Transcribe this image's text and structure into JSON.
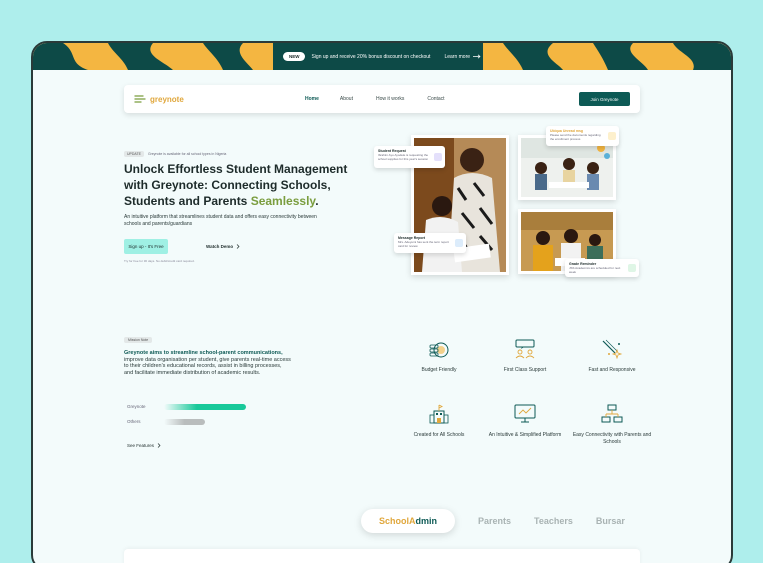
{
  "banner": {
    "badge": "NEW",
    "message": "Sign up and receive 20% bonus discount on checkout",
    "link": "Learn more"
  },
  "nav": {
    "logo": "greynote",
    "links": [
      "Home",
      "About",
      "How it works",
      "Contact"
    ],
    "active_link": "Home",
    "cta": "Join Greynote"
  },
  "hero": {
    "tag": "UPDATE",
    "tag_text": "Greynote is available for all school types in Nigeria",
    "title_main": "Unlock Effortless Student Management with Greynote: Connecting Schools, Students and Parents ",
    "title_accent": "Seamlessly",
    "title_end": ".",
    "description": "An intuitive platform that streamlines student data and offers easy connectivity between schools and parents/guardians",
    "signup_button": "Sign up - It's Free",
    "demo_button": "Watch Demo",
    "note": "Try for free for 30 days. No debit/credit card required."
  },
  "cards": {
    "student_request": {
      "title": "Student Request",
      "text": "Ibrahim Ayo Ayodele is requesting the school supplies for this year's session"
    },
    "unread": {
      "title": "Ubiqua Unread msg",
      "text": "Please send the documents regarding the enrollment process"
    },
    "message_report": {
      "title": "Message Report",
      "text": "Mrs. Adeyemi has sent the term report card for review"
    },
    "grade_reminder": {
      "title": "Grade Reminder",
      "text": "JSS Academics are scheduled for next week"
    }
  },
  "mission": {
    "tag": "Mission Note",
    "lead": "Greynote aims to streamline school-parent communications,",
    "rest": " improve data organisation per student, give parents real-time access to their children's educational records, assist in billing processes, and facilitate immediate distribution of academic results.",
    "compare": [
      {
        "label": "Greynote",
        "level": 1.0
      },
      {
        "label": "Others",
        "level": 0.5
      }
    ],
    "see_features": "See Features"
  },
  "features": [
    {
      "label": "Budget Friendly",
      "icon": "piggy-bank-icon"
    },
    {
      "label": "First Class Support",
      "icon": "support-chat-icon"
    },
    {
      "label": "Fast and Responsive",
      "icon": "sparkle-icon"
    },
    {
      "label": "Created for All Schools",
      "icon": "school-building-icon"
    },
    {
      "label": "An Intuitive & Simplified Platform",
      "icon": "monitor-icon"
    },
    {
      "label": "Easy Connectivity with Parents and Schools",
      "icon": "network-icon"
    }
  ],
  "tabs": {
    "active_part1": "School ",
    "active_part2": "A",
    "active_part3": "dmin",
    "others": [
      "Parents",
      "Teachers",
      "Bursar"
    ]
  },
  "colors": {
    "background": "#aeeeec",
    "banner": "#f4b641",
    "banner_wave": "#0d4a47",
    "primary": "#0d5a55",
    "accent": "#e0a73c",
    "mint": "#9ff0e4",
    "bar_greynote": "#18c99a",
    "bar_others": "#b9bdbd"
  }
}
